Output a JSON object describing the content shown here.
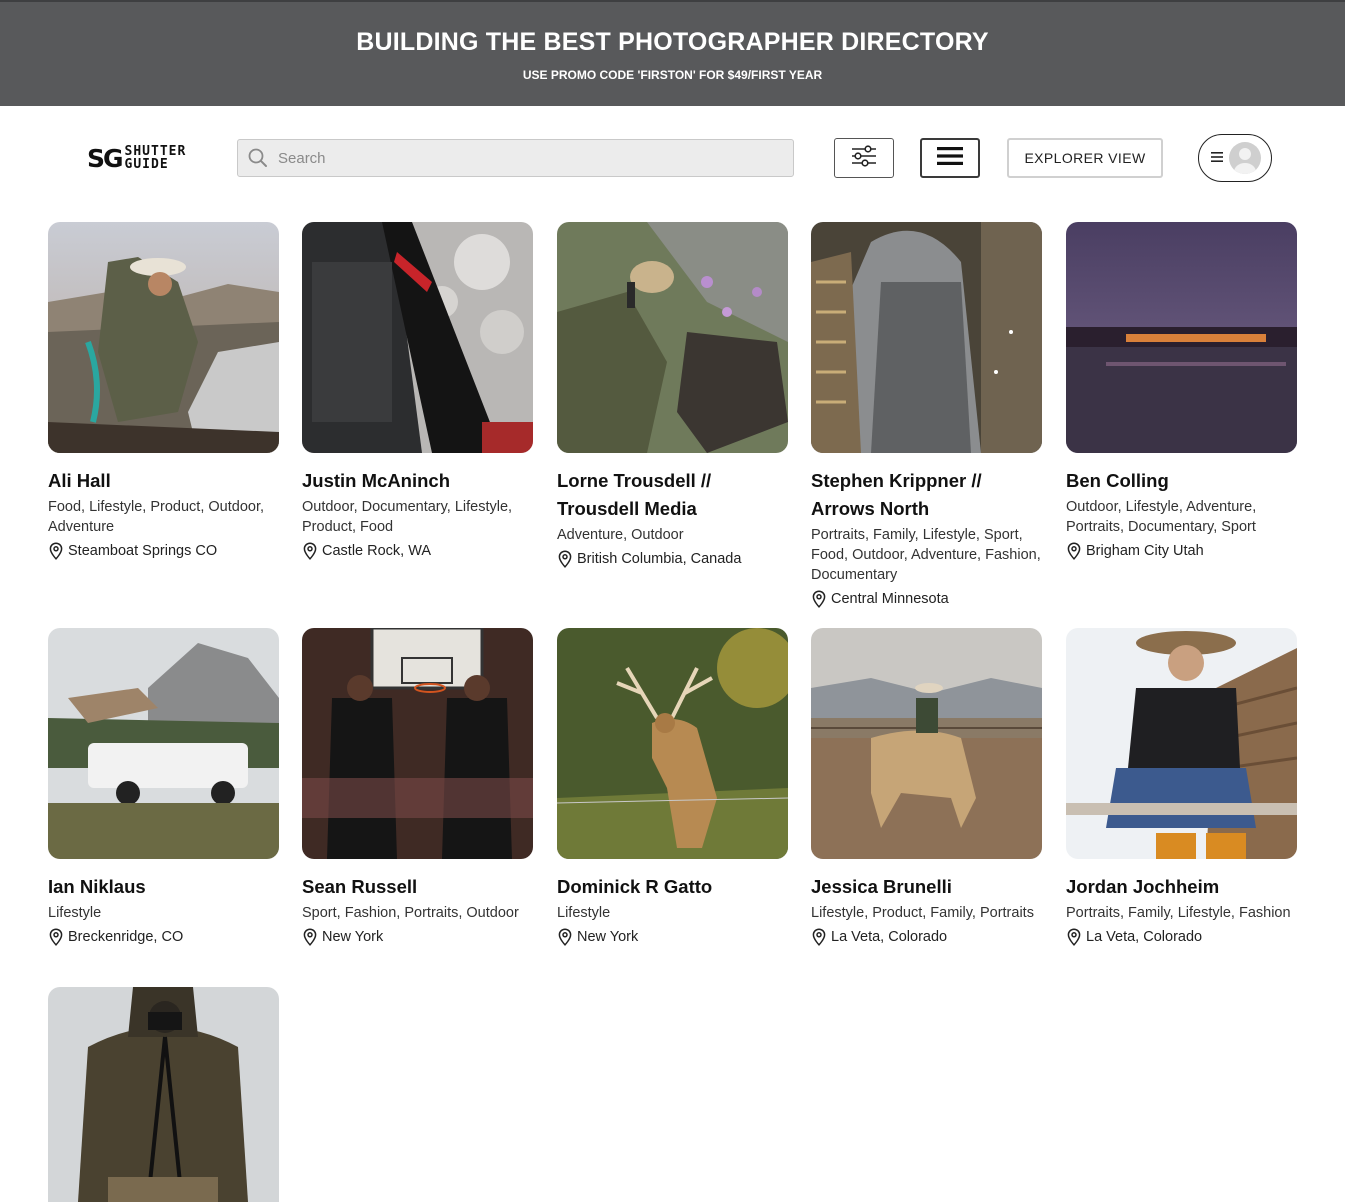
{
  "banner": {
    "title": "BUILDING THE BEST PHOTOGRAPHER DIRECTORY",
    "subtitle": "USE PROMO CODE 'FIRSTON' FOR $49/FIRST YEAR"
  },
  "header": {
    "logo_mark": "SG",
    "logo_line1": "SHUTTER",
    "logo_line2": "GUIDE",
    "search_placeholder": "Search",
    "explorer_label": "EXPLORER VIEW"
  },
  "photographers": [
    {
      "name": "Ali Hall",
      "tags": "Food, Lifestyle, Product, Outdoor, Adventure",
      "location": "Steamboat Springs CO"
    },
    {
      "name": "Justin McAninch",
      "tags": "Outdoor, Documentary, Lifestyle, Product, Food",
      "location": "Castle Rock, WA"
    },
    {
      "name": "Lorne Trousdell // Trousdell Media",
      "tags": "Adventure, Outdoor",
      "location": "British Columbia, Canada"
    },
    {
      "name": "Stephen Krippner // Arrows North",
      "tags": "Portraits, Family, Lifestyle, Sport, Food, Outdoor, Adventure, Fashion, Documentary",
      "location": "Central Minnesota"
    },
    {
      "name": "Ben Colling",
      "tags": "Outdoor, Lifestyle, Adventure, Portraits, Documentary, Sport",
      "location": "Brigham City Utah"
    },
    {
      "name": "Ian Niklaus",
      "tags": "Lifestyle",
      "location": "Breckenridge, CO"
    },
    {
      "name": "Sean Russell",
      "tags": "Sport, Fashion, Portraits, Outdoor",
      "location": "New York"
    },
    {
      "name": "Dominick R Gatto",
      "tags": "Lifestyle",
      "location": "New York"
    },
    {
      "name": "Jessica Brunelli",
      "tags": "Lifestyle, Product, Family, Portraits",
      "location": "La Veta, Colorado"
    },
    {
      "name": "Jordan Jochheim",
      "tags": "Portraits, Family, Lifestyle, Fashion",
      "location": "La Veta, Colorado"
    },
    {
      "name": "",
      "tags": "",
      "location": ""
    }
  ],
  "colors": {
    "banner_bg": "#58595b",
    "text": "#111111"
  }
}
